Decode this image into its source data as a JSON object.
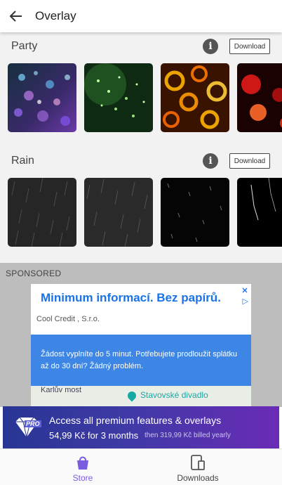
{
  "appbar": {
    "title": "Overlay",
    "back_icon": "arrow-left-icon"
  },
  "sections": [
    {
      "title": "Party",
      "download_label": "Download"
    },
    {
      "title": "Rain",
      "download_label": "Download"
    }
  ],
  "sponsored": {
    "label": "SPONSORED",
    "ad": {
      "title": "Minimum informací. Bez papírů.",
      "advertiser": "Cool Credit , S.r.o.",
      "body": "Žádost vyplníte do 5 minut. Potřebujete prodloužit splátku až do 30 dní? Žádný problém.",
      "map_label_1": "Karlův most",
      "map_label_2": "Stavovské divadlo"
    }
  },
  "promo": {
    "badge": "PRO",
    "title": "Access all premium features & overlays",
    "price": "54,99 Kč for 3 months",
    "then": "then 319,99 Kč billed yearly"
  },
  "bottom_nav": {
    "store_label": "Store",
    "downloads_label": "Downloads"
  },
  "colors": {
    "accent": "#7b5be0",
    "ad_blue": "#3d86e6",
    "promo_start": "#283593",
    "promo_end": "#6a2bb6"
  }
}
